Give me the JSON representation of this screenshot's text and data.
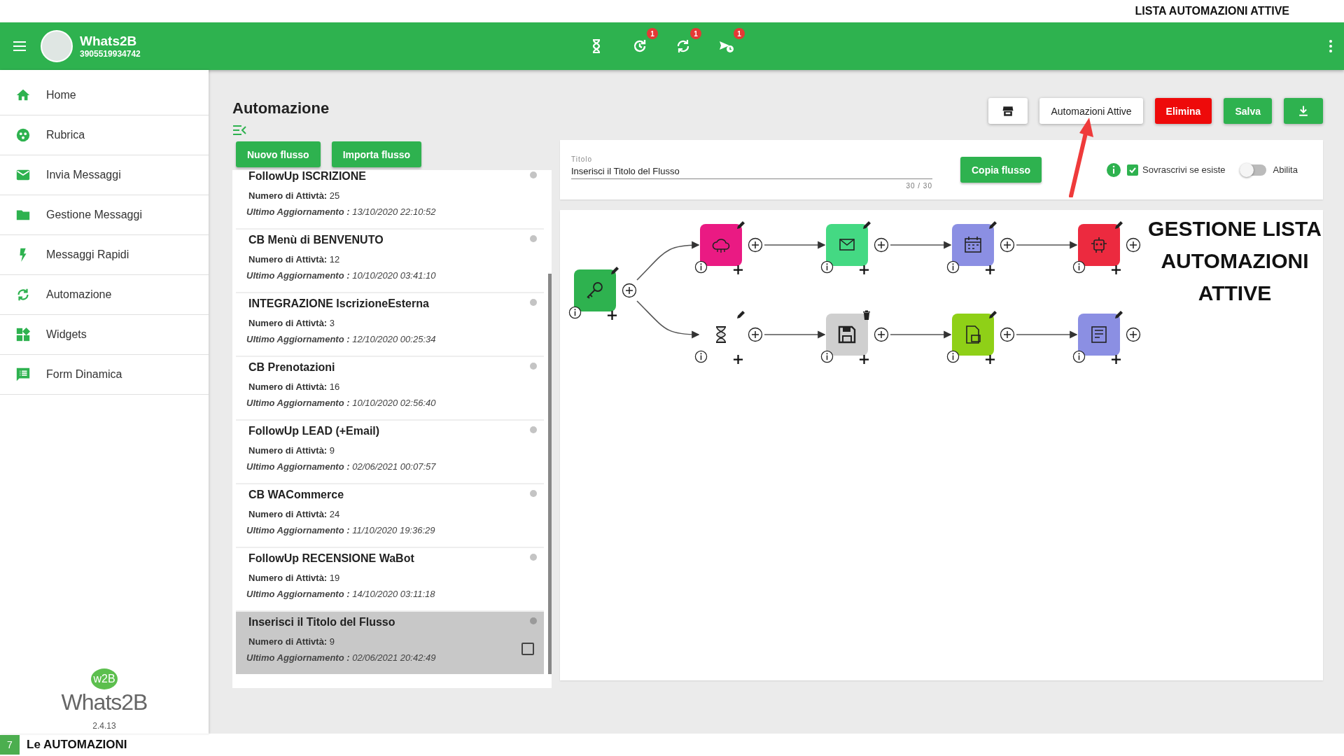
{
  "top_label": "LISTA AUTOMAZIONI ATTIVE",
  "header": {
    "app_name": "Whats2B",
    "phone": "3905519934742",
    "indicators": [
      {
        "kind": "hourglass"
      },
      {
        "kind": "history",
        "badge": "1"
      },
      {
        "kind": "sync",
        "badge": "1"
      },
      {
        "kind": "scheduled",
        "badge": "1"
      }
    ]
  },
  "sidebar": {
    "items": [
      {
        "kind": "home",
        "label": "Home",
        "selected": false
      },
      {
        "kind": "contacts",
        "label": "Rubrica",
        "selected": false
      },
      {
        "kind": "mail",
        "label": "Invia Messaggi",
        "selected": false
      },
      {
        "kind": "folder",
        "label": "Gestione Messaggi",
        "selected": false
      },
      {
        "kind": "bolt",
        "label": "Messaggi Rapidi",
        "selected": false
      },
      {
        "kind": "sync",
        "label": "Automazione",
        "selected": false
      },
      {
        "kind": "widgets",
        "label": "Widgets",
        "selected": false
      },
      {
        "kind": "form",
        "label": "Form Dinamica",
        "selected": false
      }
    ],
    "logo": {
      "mark": "w2B",
      "name": "Whats2B"
    },
    "version": "2.4.13"
  },
  "page": {
    "title": "Automazione",
    "buttons": [
      "Nuovo flusso",
      "Importa flusso"
    ]
  },
  "flows": [
    {
      "title": "FollowUp ISCRIZIONE",
      "count": "**Numero di Attivtà:** 25",
      "updated": "**Ultimo Aggiornamento :** 13/10/2020 22:10:52",
      "selected": false
    },
    {
      "title": "CB Menù di BENVENUTO",
      "count": "**Numero di Attivtà:** 12",
      "updated": "**Ultimo Aggiornamento :** 10/10/2020 03:41:10",
      "selected": false
    },
    {
      "title": "INTEGRAZIONE IscrizioneEsterna",
      "count": "**Numero di Attivtà:** 3",
      "updated": "**Ultimo Aggiornamento :** 12/10/2020 00:25:34",
      "selected": false
    },
    {
      "title": "CB Prenotazioni",
      "count": "**Numero di Attivtà:** 16",
      "updated": "**Ultimo Aggiornamento :** 10/10/2020 02:56:40",
      "selected": false
    },
    {
      "title": "FollowUp LEAD (+Email)",
      "count": "**Numero di Attivtà:** 9",
      "updated": "**Ultimo Aggiornamento :** 02/06/2021 00:07:57",
      "selected": false
    },
    {
      "title": "CB WACommerce",
      "count": "**Numero di Attivtà:** 24",
      "updated": "**Ultimo Aggiornamento :** 11/10/2020 19:36:29",
      "selected": false
    },
    {
      "title": "FollowUp RECENSIONE WaBot",
      "count": "**Numero di Attivtà:** 19",
      "updated": "**Ultimo Aggiornamento :** 14/10/2020 03:11:18",
      "selected": false
    },
    {
      "title": "Inserisci il Titolo del Flusso",
      "count": "**Numero di Attivtà:** 9",
      "updated": "**Ultimo Aggiornamento :** 02/06/2021 20:42:49",
      "selected": true,
      "checked": false
    }
  ],
  "toolbar": {
    "buttons": [
      {
        "kind": "store"
      },
      {
        "kind": "outline",
        "label": "Automazioni Attive"
      },
      {
        "kind": "danger",
        "label": "Elimina"
      },
      {
        "kind": "primary",
        "label": "Salva"
      },
      {
        "kind": "download"
      }
    ]
  },
  "title_field": {
    "label": "Titolo",
    "value": "Inserisci il Titolo del Flusso",
    "counter": "30 / 30"
  },
  "copy_button": "Copia flusso",
  "overwrite": {
    "label": "Sovrascrivi se esiste",
    "checked": true
  },
  "enable": {
    "label": "Abilita",
    "on": false
  },
  "flow": {
    "trigger": {
      "kind": "key",
      "color": "#2eb24f",
      "deletable": false
    },
    "branches": [
      [
        {
          "kind": "api",
          "color": "#ea1a83",
          "deletable": false
        },
        {
          "kind": "mail",
          "color": "#44d983",
          "deletable": false
        },
        {
          "kind": "calendar",
          "color": "#8b8fe3",
          "deletable": false
        },
        {
          "kind": "robot",
          "color": "#ec2a3f",
          "deletable": false
        }
      ],
      [
        {
          "kind": "hourglass",
          "color": "#ffffff",
          "deletable": false
        },
        {
          "kind": "save",
          "color": "#cfcfcf",
          "deletable": true
        },
        {
          "kind": "document",
          "color": "#8fd017",
          "deletable": false
        },
        {
          "kind": "form",
          "color": "#8b8fe3",
          "deletable": false
        }
      ]
    ]
  },
  "annotation": "GESTIONE LISTA AUTOMAZIONI ATTIVE",
  "footer": {
    "number": "7",
    "title": "Le AUTOMAZIONI"
  }
}
